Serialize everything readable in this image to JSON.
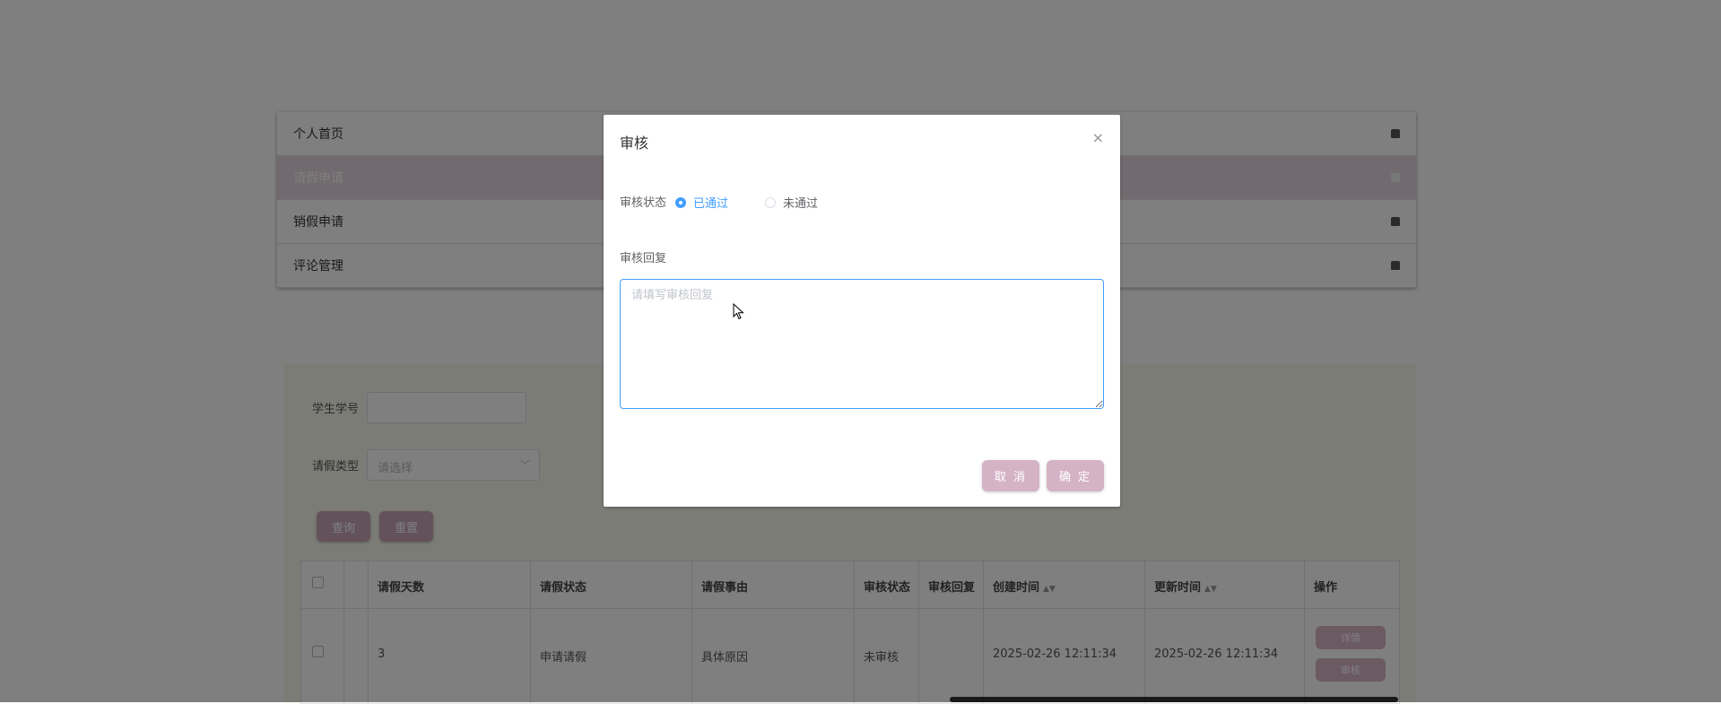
{
  "menu": {
    "items": [
      {
        "label": "个人首页",
        "active": false
      },
      {
        "label": "请假申请",
        "active": true
      },
      {
        "label": "销假申请",
        "active": false
      },
      {
        "label": "评论管理",
        "active": false
      }
    ]
  },
  "search": {
    "student_id_label": "学生学号",
    "leave_type_label": "请假类型",
    "leave_type_placeholder": "请选择",
    "query_button": "查询",
    "reset_button": "重置"
  },
  "table": {
    "headers": [
      "请假天数",
      "请假状态",
      "请假事由",
      "审核状态",
      "审核回复",
      "创建时间",
      "更新时间",
      "操作"
    ],
    "rows": [
      {
        "days": "3",
        "leave_status": "申请请假",
        "reason": "具体原因",
        "review_status": "未审核",
        "review_reply": "",
        "created": "2025-02-26 12:11:34",
        "updated": "2025-02-26 12:11:34",
        "detail_button": "详情",
        "review_button": "审核"
      }
    ]
  },
  "dialog": {
    "title": "审核",
    "close_glyph": "×",
    "status_label": "审核状态",
    "options": [
      {
        "label": "已通过",
        "checked": true
      },
      {
        "label": "未通过",
        "checked": false
      }
    ],
    "reply_label": "审核回复",
    "reply_value": "",
    "reply_placeholder": "请填写审核回复",
    "cancel_button": "取 消",
    "confirm_button": "确 定"
  },
  "icons": {
    "menu_item": "home-icon",
    "sort": "sort-caret-icon",
    "select_arrow": "chevron-down-icon",
    "close": "close-icon"
  },
  "colors": {
    "accent": "#409eff",
    "menu_active": "#e3d4dd",
    "button": "#d5b3c6"
  }
}
